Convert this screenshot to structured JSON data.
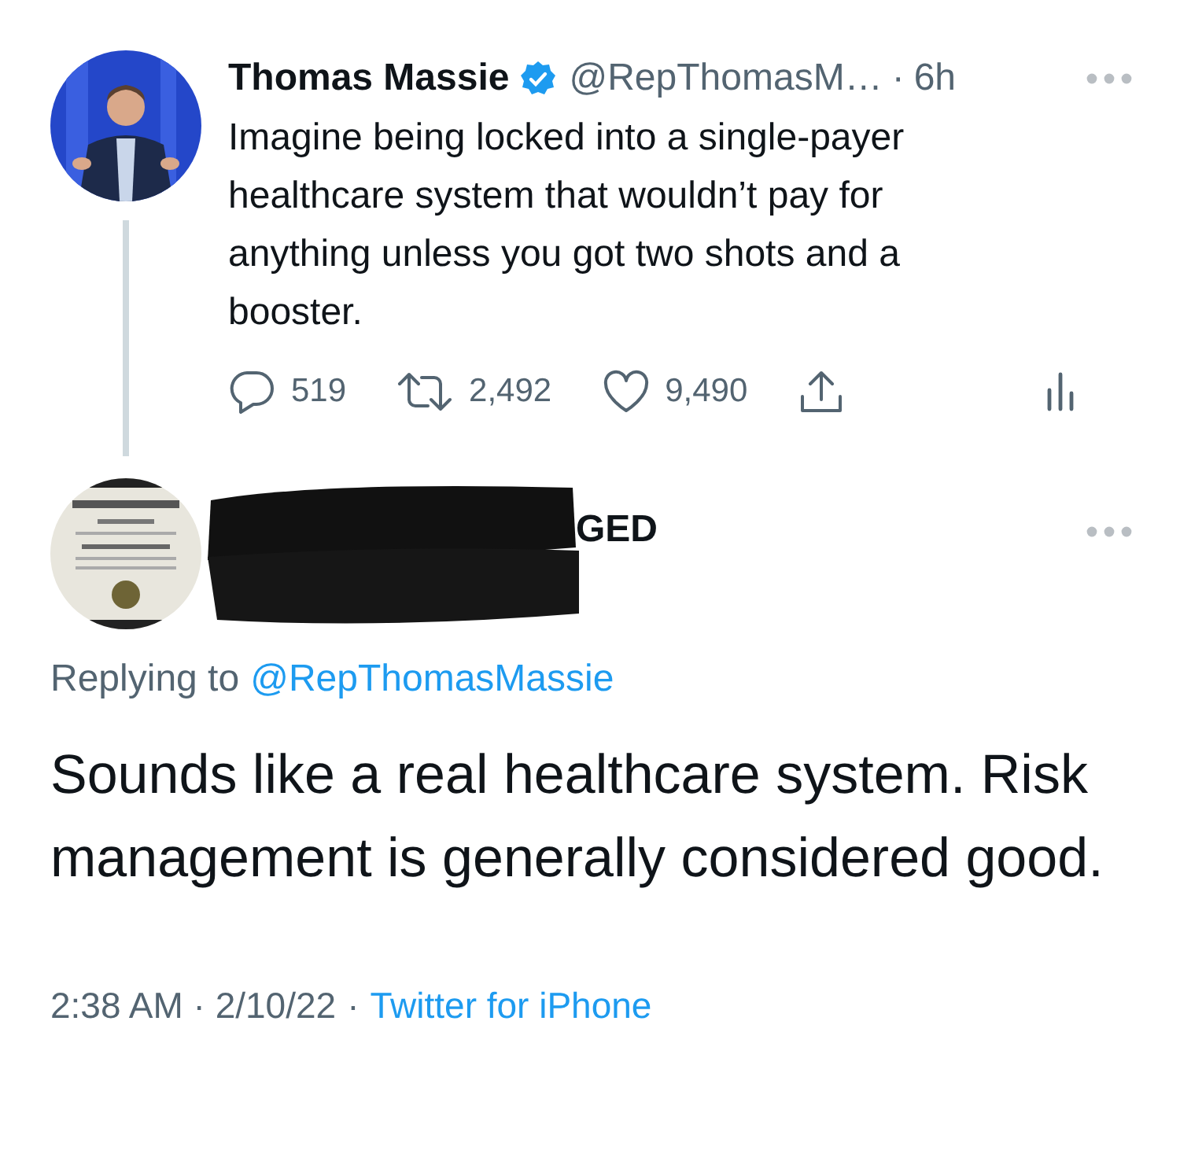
{
  "tweet": {
    "author": {
      "name": "Thomas Massie",
      "verified": true,
      "handle": "@RepThomasM…",
      "separator": "·",
      "time": "6h"
    },
    "text": "Imagine being locked into a single-payer healthcare system that wouldn’t pay for anything unless you got two shots and a booster.",
    "actions": [
      {
        "kind": "reply",
        "count": "519"
      },
      {
        "kind": "retweet",
        "count": "2,492"
      },
      {
        "kind": "like",
        "count": "9,490"
      },
      {
        "kind": "share"
      }
    ]
  },
  "reply": {
    "author": {
      "name_visible": "GED"
    },
    "replying_to": {
      "label": "Replying to",
      "handle": "@RepThomasMassie"
    },
    "text": "Sounds like a real healthcare system. Risk management is generally considered good.",
    "timestamp": "2:38 AM · 2/10/22",
    "separator": "·",
    "source": "Twitter for iPhone"
  }
}
